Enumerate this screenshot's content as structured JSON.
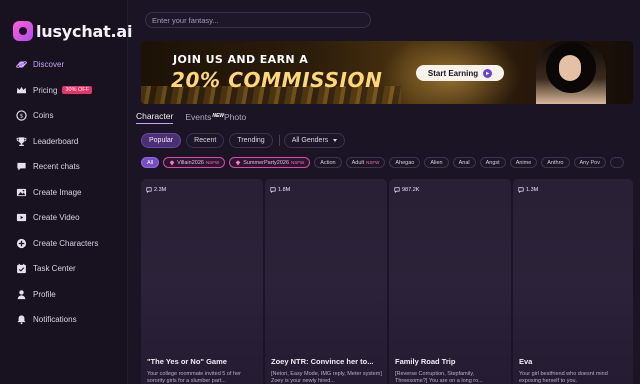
{
  "brand": {
    "name": "lusychat.ai",
    "logo_color": "#e24fd6"
  },
  "sidebar": {
    "items": [
      {
        "label": "Discover",
        "icon": "planet-icon",
        "active": true
      },
      {
        "label": "Pricing",
        "icon": "crown-icon",
        "badge": "30% OFF"
      },
      {
        "label": "Coins",
        "icon": "coin-icon"
      },
      {
        "label": "Leaderboard",
        "icon": "trophy-icon"
      },
      {
        "label": "Recent chats",
        "icon": "chat-icon"
      },
      {
        "label": "Create Image",
        "icon": "image-icon"
      },
      {
        "label": "Create Video",
        "icon": "video-icon"
      },
      {
        "label": "Create Characters",
        "icon": "plus-circle-icon"
      },
      {
        "label": "Task Center",
        "icon": "calendar-check-icon"
      },
      {
        "label": "Profile",
        "icon": "user-icon"
      },
      {
        "label": "Notifications",
        "icon": "bell-icon"
      }
    ]
  },
  "search": {
    "placeholder": "Enter your fantasy..."
  },
  "banner": {
    "line1": "JOIN US AND EARN A",
    "line2": "20% COMMISSION",
    "button": "Start Earning"
  },
  "tabs": [
    {
      "label": "Character",
      "active": true
    },
    {
      "label": "Events",
      "badge": "NEW"
    },
    {
      "label": "Photo"
    }
  ],
  "filters": {
    "sort": [
      "Popular",
      "Recent",
      "Trending"
    ],
    "active_sort": "Popular",
    "gender": "All Genders"
  },
  "chips": [
    {
      "label": "All",
      "active": true
    },
    {
      "label": "Villain2026",
      "nsfw": "NSFW",
      "hot": true
    },
    {
      "label": "SummerParty2026",
      "nsfw": "NSFW",
      "hot": true
    },
    {
      "label": "Action"
    },
    {
      "label": "Adult",
      "nsfw": "NSFW"
    },
    {
      "label": "Ahegao"
    },
    {
      "label": "Alien"
    },
    {
      "label": "Anal"
    },
    {
      "label": "Angst"
    },
    {
      "label": "Anime"
    },
    {
      "label": "Anthro"
    },
    {
      "label": "Any Pov"
    },
    {
      "label": ""
    }
  ],
  "cards": [
    {
      "views": "2.3M",
      "title": "\"The Yes or No\" Game",
      "desc": "Your college roommate invited 5 of her sorority girls for a slumber part..."
    },
    {
      "views": "1.8M",
      "title": "Zoey NTR: Convince her to...",
      "desc": "[Netori, Easy Mode, IMG reply, Meter system] Zoey is your newly hired..."
    },
    {
      "views": "987.2K",
      "title": "Family Road Trip",
      "desc": "[Reverse Corruption, Stepfamily, Threesome?] You are on a long ro..."
    },
    {
      "views": "1.3M",
      "title": "Eva",
      "desc": "Your girl bestfriend who doesnt mind exposing herself to you."
    }
  ],
  "colors": {
    "accent": "#c7a1ff",
    "background": "#1a1424",
    "sidebar": "#171120",
    "banner_gold": "#ffd873"
  }
}
